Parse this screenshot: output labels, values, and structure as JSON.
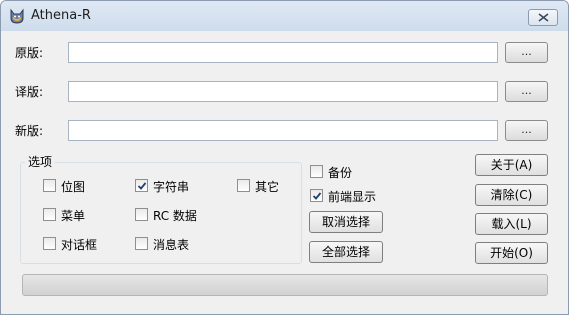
{
  "window": {
    "title": "Athena-R",
    "icon": "cat-head-icon"
  },
  "fields": [
    {
      "label": "原版:",
      "value": "",
      "browse": "..."
    },
    {
      "label": "译版:",
      "value": "",
      "browse": "..."
    },
    {
      "label": "新版:",
      "value": "",
      "browse": "..."
    }
  ],
  "options": {
    "title": "选项",
    "items": [
      {
        "label": "位图",
        "checked": false
      },
      {
        "label": "字符串",
        "checked": true
      },
      {
        "label": "其它",
        "checked": false
      },
      {
        "label": "菜单",
        "checked": false
      },
      {
        "label": "RC 数据",
        "checked": false
      },
      {
        "label": "对话框",
        "checked": false
      },
      {
        "label": "消息表",
        "checked": false
      }
    ]
  },
  "extras": [
    {
      "label": "备份",
      "checked": false
    },
    {
      "label": "前端显示",
      "checked": true
    }
  ],
  "select_buttons": {
    "clear": "取消选择",
    "all": "全部选择"
  },
  "side_buttons": {
    "about": "关于(A)",
    "clear": "清除(C)",
    "load": "载入(L)",
    "start": "开始(O)"
  },
  "progress": {
    "value": 0
  }
}
